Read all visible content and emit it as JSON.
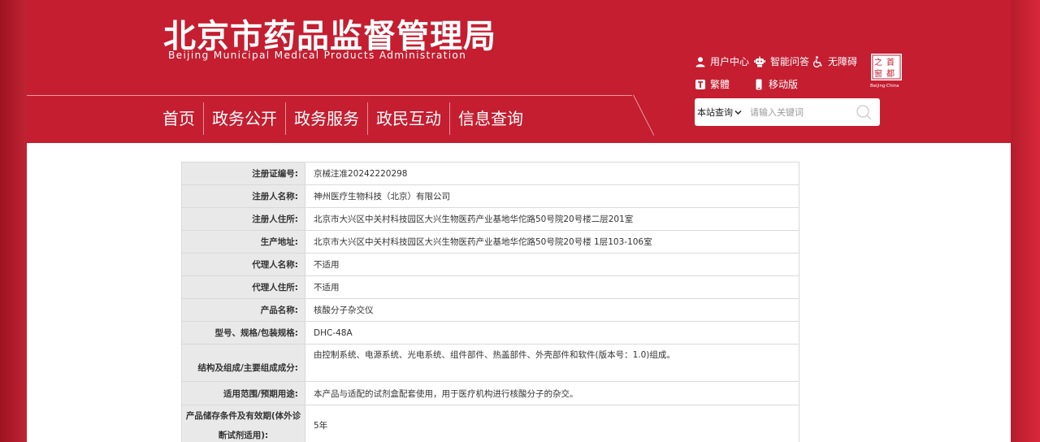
{
  "header": {
    "logo_cn": "北京市药品监督管理局",
    "logo_en": "Beijing Municipal Medical Products Administration",
    "utilities": {
      "user_center": "用户中心",
      "smart_qa": "智能问答",
      "accessibility": "无障碍",
      "traditional": "繁體",
      "mobile": "移动版"
    },
    "seal_text": "Beijing·China"
  },
  "nav": {
    "items": [
      "首页",
      "政务公开",
      "政务服务",
      "政民互动",
      "信息查询"
    ]
  },
  "search": {
    "scope": "本站查询",
    "placeholder": "请输入关键词"
  },
  "record": {
    "rows": [
      {
        "label": "注册证编号:",
        "value": "京械注准20242220298"
      },
      {
        "label": "注册人名称:",
        "value": "神州医疗生物科技（北京）有限公司"
      },
      {
        "label": "注册人住所:",
        "value": "北京市大兴区中关村科技园区大兴生物医药产业基地华佗路50号院20号楼二层201室"
      },
      {
        "label": "生产地址:",
        "value": "北京市大兴区中关村科技园区大兴生物医药产业基地华佗路50号院20号楼 1层103-106室"
      },
      {
        "label": "代理人名称:",
        "value": "不适用"
      },
      {
        "label": "代理人住所:",
        "value": "不适用"
      },
      {
        "label": "产品名称:",
        "value": "核酸分子杂交仪"
      },
      {
        "label": "型号、规格/包装规格:",
        "value": "DHC-48A"
      },
      {
        "label": "结构及组成/主要组成成分:",
        "value": "由控制系统、电源系统、光电系统、组件部件、热盖部件、外壳部件和软件(版本号：1.0)组成。"
      },
      {
        "label": "适用范围/预期用途:",
        "value": "本产品与适配的试剂盒配套使用，用于医疗机构进行核酸分子的杂交。"
      },
      {
        "label": "产品储存条件及有效期(体外诊断试剂适用):",
        "value": "5年"
      }
    ]
  }
}
